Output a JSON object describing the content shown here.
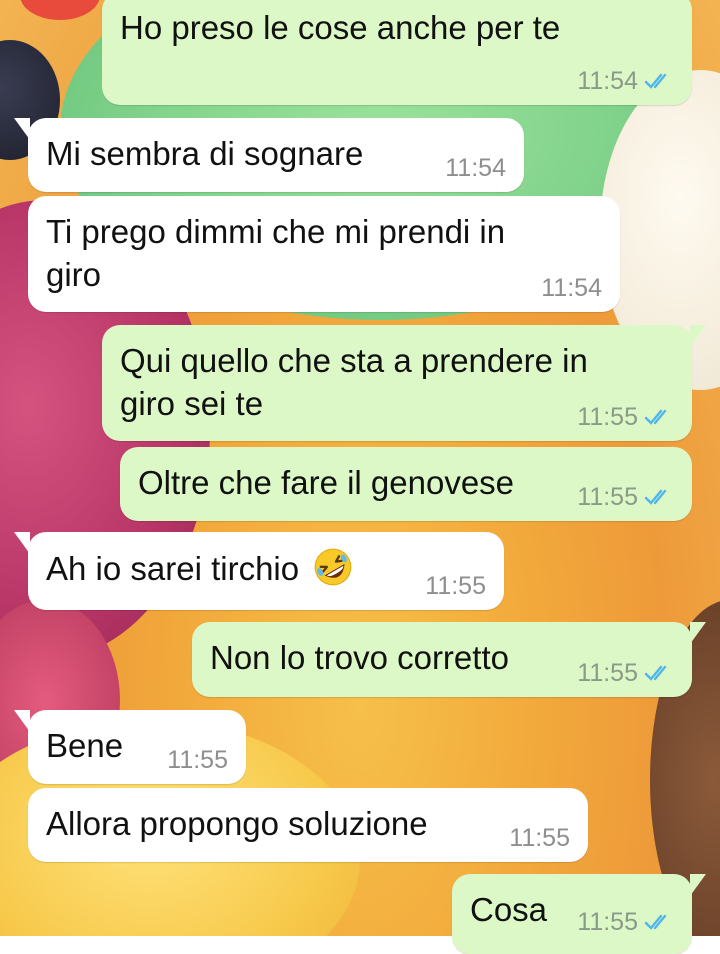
{
  "messages": [
    {
      "direction": "out",
      "text": "Ho preso le cose anche per te",
      "time": "11:54",
      "read": true
    },
    {
      "direction": "in",
      "text": "Mi sembra di sognare",
      "time": "11:54"
    },
    {
      "direction": "in",
      "text": "Ti prego dimmi che mi prendi in giro",
      "time": "11:54"
    },
    {
      "direction": "out",
      "text": "Qui quello che sta a prendere in giro sei te",
      "time": "11:55",
      "read": true
    },
    {
      "direction": "out",
      "text": "Oltre che fare il genovese",
      "time": "11:55",
      "read": true
    },
    {
      "direction": "in",
      "text": "Ah io sarei tirchio",
      "emoji": "rolling-on-floor-laughing",
      "time": "11:55"
    },
    {
      "direction": "out",
      "text": "Non lo trovo corretto",
      "time": "11:55",
      "read": true
    },
    {
      "direction": "in",
      "text": "Bene",
      "time": "11:55"
    },
    {
      "direction": "in",
      "text": "Allora propongo soluzione",
      "time": "11:55"
    },
    {
      "direction": "out",
      "text": "Cosa",
      "time": "11:55",
      "read": true
    }
  ],
  "colors": {
    "outgoing_bubble": "#dcf8c6",
    "incoming_bubble": "#ffffff",
    "read_ticks": "#4fb6ec"
  },
  "wallpaper": "ice-cream-scoops"
}
